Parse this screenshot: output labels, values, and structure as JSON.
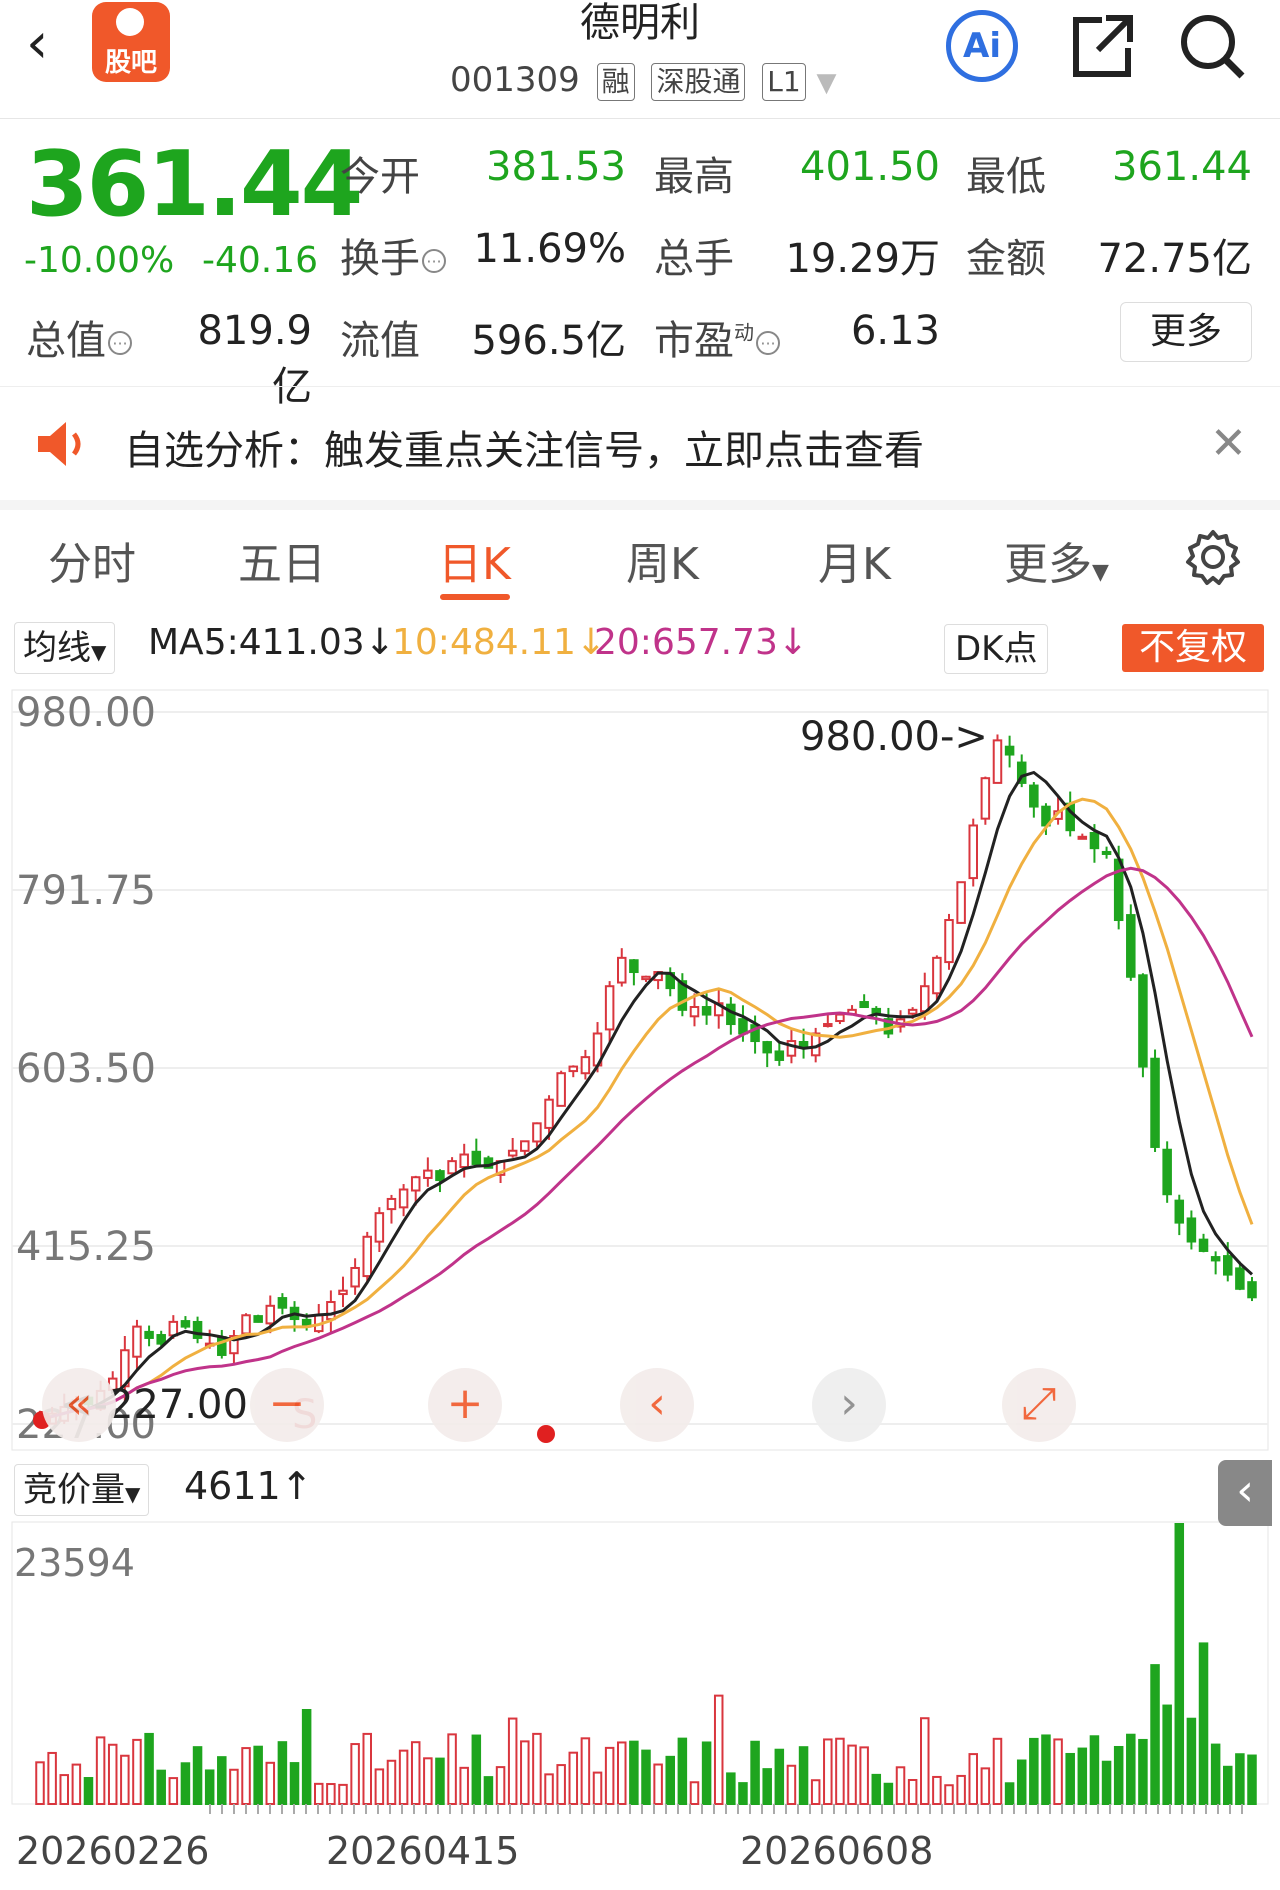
{
  "header": {
    "title": "德明利",
    "code": "001309",
    "tags": [
      "融",
      "深股通",
      "L1"
    ],
    "logo_text": "股吧",
    "ai_label": "Ai"
  },
  "quote": {
    "price": "361.44",
    "change_pct": "-10.00%",
    "change": "-40.16",
    "open_label": "今开",
    "open": "381.53",
    "high_label": "最高",
    "high": "401.50",
    "low_label": "最低",
    "low": "361.44",
    "turnover_label": "换手",
    "turnover": "11.69%",
    "volume_label": "总手",
    "volume": "19.29万",
    "amount_label": "金额",
    "amount": "72.75亿",
    "mktcap_label": "总值",
    "mktcap": "819.9亿",
    "float_label": "流值",
    "float": "596.5亿",
    "pe_label": "市盈",
    "pe_sup": "动",
    "pe": "6.13",
    "more": "更多",
    "colors": {
      "down": "#1ea51e",
      "up": "#d9363e",
      "accent": "#f0582a"
    }
  },
  "notice": {
    "text": "自选分析：触发重点关注信号，立即点击查看"
  },
  "tabs": [
    "分时",
    "五日",
    "日K",
    "周K",
    "月K",
    "更多"
  ],
  "active_tab": "日K",
  "ma": {
    "selector": "均线",
    "ma5": "MA5:411.03",
    "ma10": "10:484.11",
    "ma20": "20:657.73",
    "arrow": "↓",
    "dk": "DK点",
    "adjust": "不复权",
    "colors": {
      "ma5": "#222222",
      "ma10": "#f0b040",
      "ma20": "#c0338a"
    }
  },
  "chart_data": {
    "type": "candlestick",
    "y_ticks": [
      "980.00",
      "791.75",
      "603.50",
      "415.25",
      "227.00"
    ],
    "ylim": [
      227.0,
      980.0
    ],
    "max_marker": "980.00->",
    "min_marker": "<-227.00",
    "s_marker": "S",
    "x_labels": [
      "20260226",
      "20260415",
      "20260608"
    ],
    "volume_label": "竞价量",
    "volume_value": "4611",
    "volume_arrow": "↑",
    "volume_max": "23594",
    "close": [
      232,
      238,
      245,
      252,
      248,
      262,
      275,
      305,
      330,
      318,
      312,
      335,
      330,
      318,
      312,
      300,
      320,
      342,
      335,
      352,
      350,
      338,
      330,
      342,
      356,
      368,
      392,
      425,
      450,
      465,
      475,
      488,
      495,
      485,
      505,
      512,
      502,
      498,
      505,
      516,
      526,
      545,
      570,
      598,
      605,
      615,
      640,
      690,
      720,
      705,
      700,
      705,
      688,
      665,
      668,
      660,
      672,
      650,
      640,
      632,
      620,
      612,
      632,
      625,
      640,
      650,
      660,
      665,
      668,
      660,
      640,
      655,
      665,
      690,
      720,
      760,
      800,
      860,
      910,
      950,
      935,
      905,
      880,
      860,
      875,
      855,
      848,
      836,
      830,
      760,
      700,
      605,
      520,
      470,
      440,
      420,
      410,
      400,
      385,
      370,
      361
    ]
  }
}
